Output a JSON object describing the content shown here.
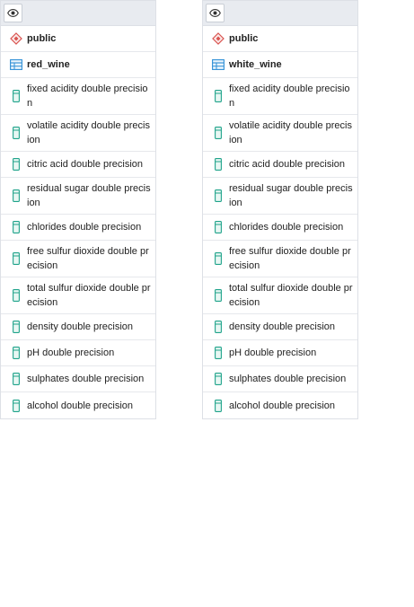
{
  "colors": {
    "header_bg": "#e8ebf0",
    "border": "#dde0e6",
    "schema_icon": "#d9534f",
    "table_icon": "#2f8fd6",
    "column_icon": "#1fa38a"
  },
  "panels": [
    {
      "schema": "public",
      "table": "red_wine",
      "columns": [
        "fixed acidity double precision",
        "volatile acidity double precision",
        "citric acid double precision",
        "residual sugar double precision",
        "chlorides double precision",
        "free sulfur dioxide double precision",
        "total sulfur dioxide double precision",
        "density double precision",
        "pH double precision",
        "sulphates double precision",
        "alcohol double precision"
      ]
    },
    {
      "schema": "public",
      "table": "white_wine",
      "columns": [
        "fixed acidity double precision",
        "volatile acidity double precision",
        "citric acid double precision",
        "residual sugar double precision",
        "chlorides double precision",
        "free sulfur dioxide double precision",
        "total sulfur dioxide double precision",
        "density double precision",
        "pH double precision",
        "sulphates double precision",
        "alcohol double precision"
      ]
    }
  ],
  "icons": {
    "toggle": "eye-icon",
    "schema": "schema-diamond-icon",
    "table": "table-icon",
    "column": "column-icon"
  }
}
